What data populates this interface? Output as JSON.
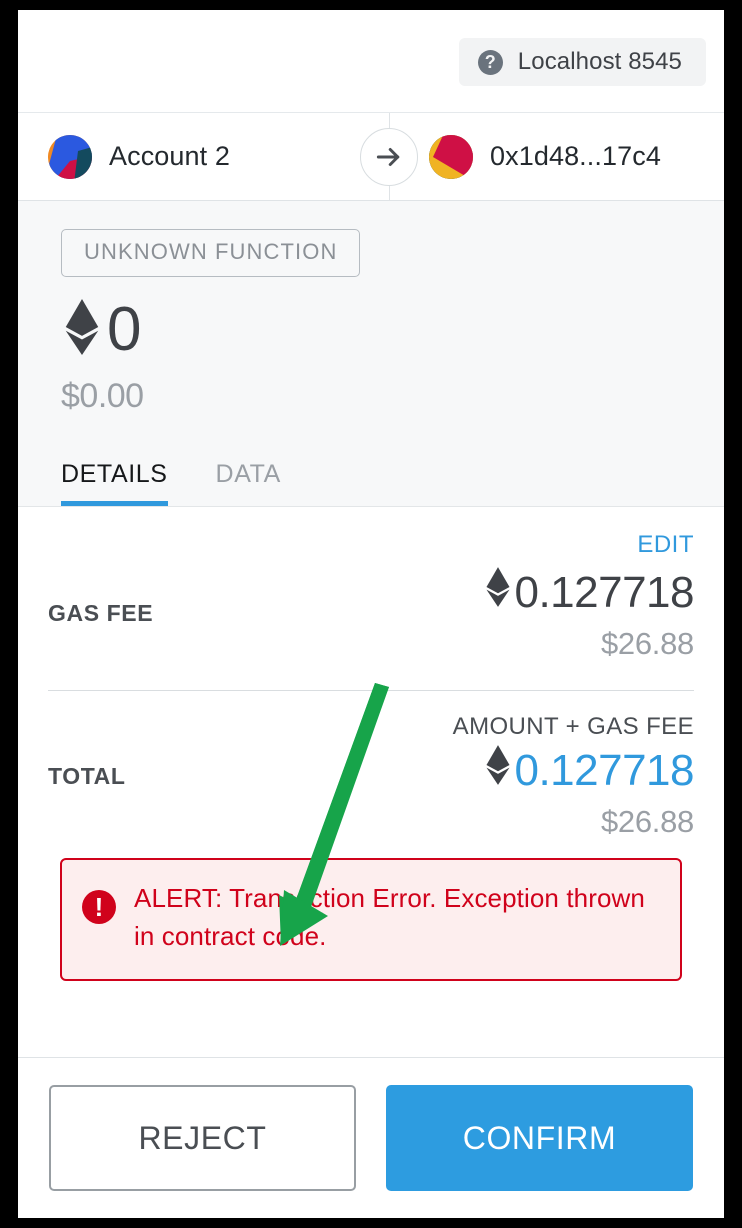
{
  "window": {
    "network": {
      "icon": "question-mark-icon",
      "label": "Localhost 8545"
    }
  },
  "transfer": {
    "sender": {
      "name": "Account 2",
      "avatar": "jazzicon-sender"
    },
    "arrow_icon": "arrow-right-icon",
    "recipient": {
      "name": "0x1d48...17c4",
      "avatar": "jazzicon-recipient"
    }
  },
  "summary": {
    "function_tag": "UNKNOWN FUNCTION",
    "currency_icon": "ethereum-icon",
    "amount": "0",
    "fiat_amount": "$0.00"
  },
  "tabs": [
    {
      "label": "DETAILS",
      "active": true
    },
    {
      "label": "DATA",
      "active": false
    }
  ],
  "details": {
    "edit_label": "EDIT",
    "gas_fee": {
      "label": "GAS FEE",
      "currency_icon": "ethereum-icon",
      "value": "0.127718",
      "fiat": "$26.88"
    },
    "total": {
      "label": "TOTAL",
      "sub_label": "AMOUNT + GAS FEE",
      "currency_icon": "ethereum-icon",
      "value": "0.127718",
      "fiat": "$26.88"
    }
  },
  "alert": {
    "icon": "exclamation-icon",
    "message": "ALERT: Transaction Error. Exception thrown in contract code."
  },
  "footer": {
    "reject_label": "REJECT",
    "confirm_label": "CONFIRM"
  },
  "annotation": {
    "type": "green-arrow",
    "color": "#17a44a"
  },
  "colors": {
    "accent_blue": "#3099dd",
    "confirm_blue": "#2d9ce0",
    "error_red": "#d0021b",
    "error_bg": "#fdeeee",
    "annotation_green": "#17a44a",
    "summary_bg": "#f7f8f9",
    "muted_text": "#9a9fa5"
  }
}
